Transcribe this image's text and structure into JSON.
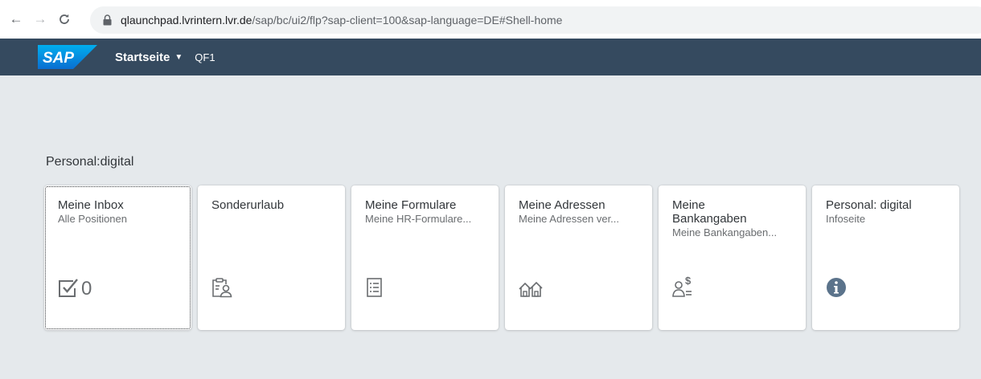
{
  "browser": {
    "url_host": "qlaunchpad.lvrintern.lvr.de",
    "url_path": "/sap/bc/ui2/flp?sap-client=100&sap-language=DE#Shell-home",
    "icons": [
      "arrow-left-icon",
      "arrow-right-icon",
      "reload-icon",
      "lock-icon"
    ]
  },
  "shell": {
    "logo_text": "SAP",
    "title": "Startseite",
    "system": "QF1",
    "colors": {
      "bar": "#354a5f",
      "logo": "#0a6ed1"
    }
  },
  "group": {
    "title": "Personal:digital",
    "tiles": [
      {
        "title": "Meine Inbox",
        "subtitle": "Alle Positionen",
        "icon": "task-checkbox-icon",
        "count": "0"
      },
      {
        "title": "Sonderurlaub",
        "subtitle": "",
        "icon": "clipboard-person-icon"
      },
      {
        "title": "Meine Formulare",
        "subtitle": "Meine HR-Formulare...",
        "icon": "form-list-icon"
      },
      {
        "title": "Meine Adressen",
        "subtitle": "Meine Adressen ver...",
        "icon": "houses-icon"
      },
      {
        "title": "Meine Bankangaben",
        "subtitle": "Meine Bankangaben...",
        "icon": "person-money-icon"
      },
      {
        "title": "Personal: digital",
        "subtitle": "Infoseite",
        "icon": "info-icon"
      }
    ]
  }
}
